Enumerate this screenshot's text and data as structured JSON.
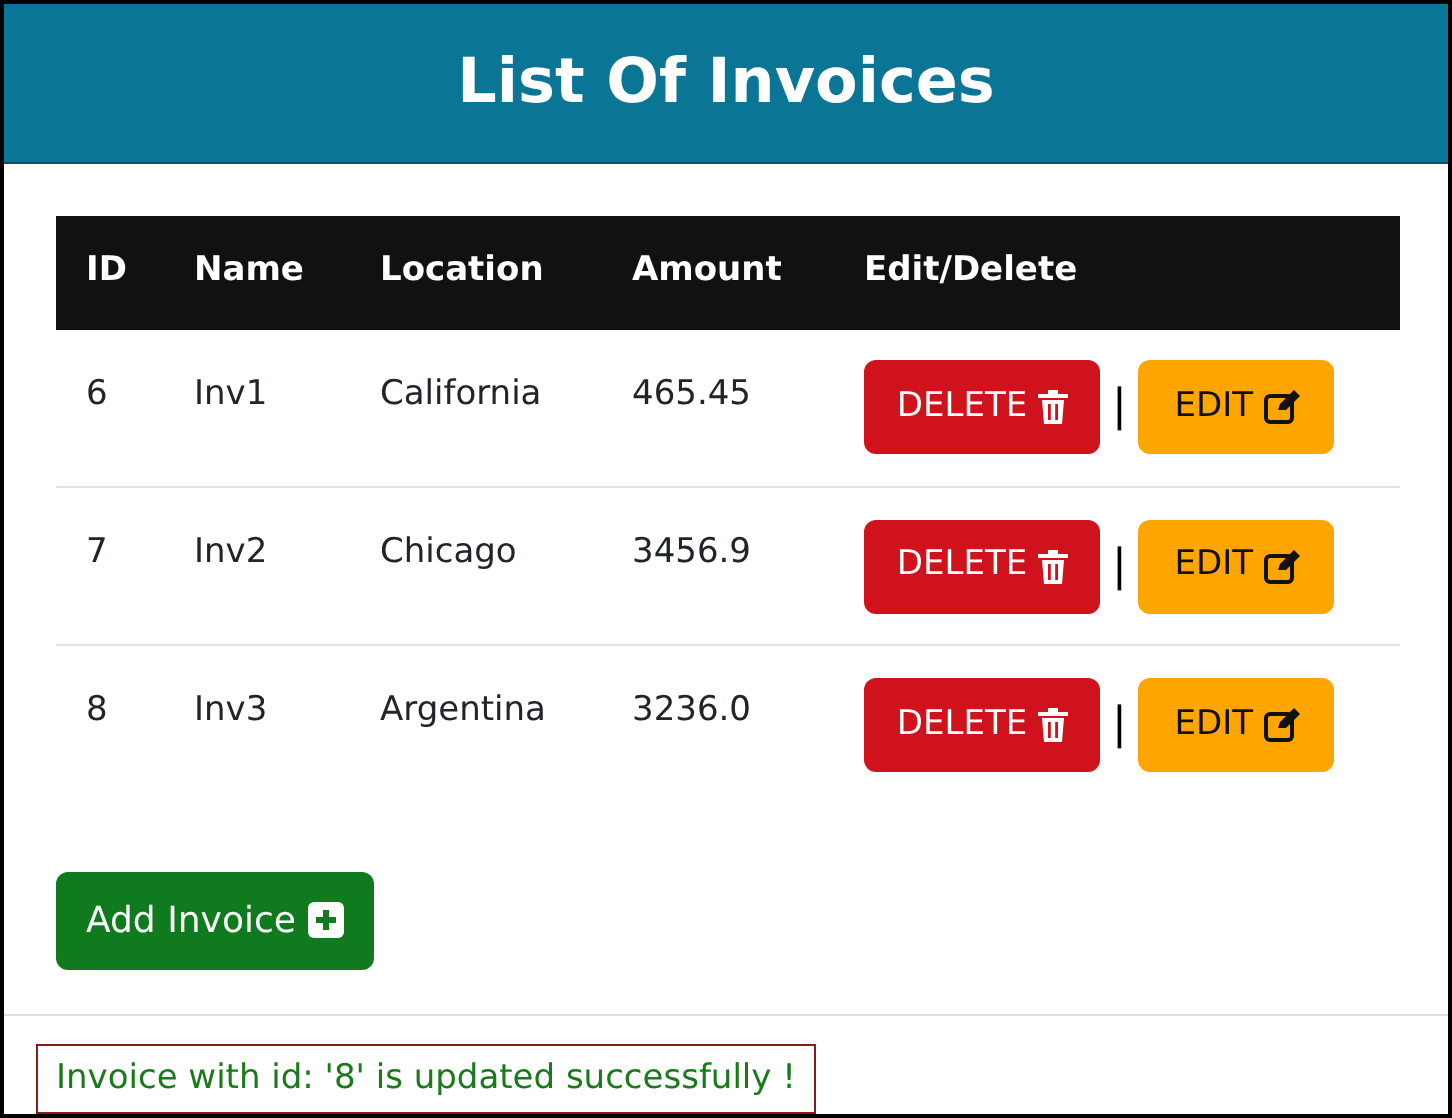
{
  "header": {
    "title": "List Of Invoices"
  },
  "table": {
    "columns": [
      "ID",
      "Name",
      "Location",
      "Amount",
      "Edit/Delete"
    ],
    "rows": [
      {
        "cells": [
          "6",
          "Inv1",
          "California",
          "465.45"
        ],
        "delete_label": "DELETE",
        "separator": "|",
        "edit_label": "EDIT"
      },
      {
        "cells": [
          "7",
          "Inv2",
          "Chicago",
          "3456.9"
        ],
        "delete_label": "DELETE",
        "separator": "|",
        "edit_label": "EDIT"
      },
      {
        "cells": [
          "8",
          "Inv3",
          "Argentina",
          "3236.0"
        ],
        "delete_label": "DELETE",
        "separator": "|",
        "edit_label": "EDIT"
      }
    ]
  },
  "add_button": {
    "label": "Add Invoice"
  },
  "message": "Invoice with id: '8' is updated successfully !"
}
